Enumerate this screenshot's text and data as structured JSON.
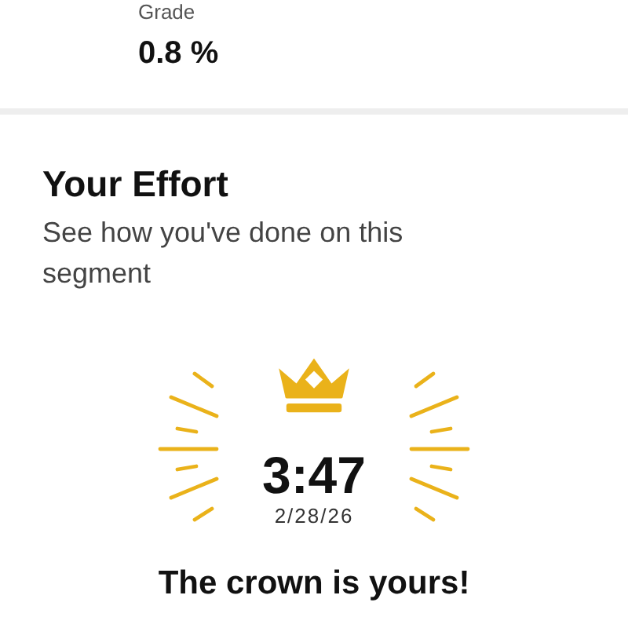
{
  "stat": {
    "label": "Grade",
    "value": "0.8 %"
  },
  "effort": {
    "title": "Your Effort",
    "subtitle": "See how you've done on this segment",
    "time": "3:47",
    "date": "2/28/26",
    "message": "The crown is yours!"
  }
}
